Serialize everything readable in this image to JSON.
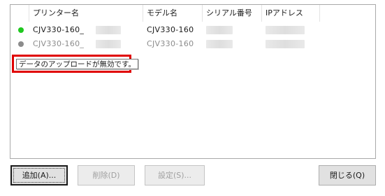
{
  "columns": {
    "printer_name": "プリンター名",
    "model_name": "モデル名",
    "serial_number": "シリアル番号",
    "ip_address": "IPアドレス"
  },
  "rows": [
    {
      "status_color": "#1fc81f",
      "printer_name": "CJV330-160_",
      "model_name": "CJV330-160",
      "enabled": true
    },
    {
      "status_color": "#8c8c8c",
      "printer_name": "CJV330-160_",
      "model_name": "CJV330-160",
      "enabled": false
    }
  ],
  "tooltip": {
    "text": "データのアップロードが無効です。",
    "highlight_color": "#e00000"
  },
  "buttons": {
    "add": "追加(A)...",
    "delete": "削除(D)",
    "settings": "設定(S)...",
    "close": "閉じる(Q)"
  }
}
